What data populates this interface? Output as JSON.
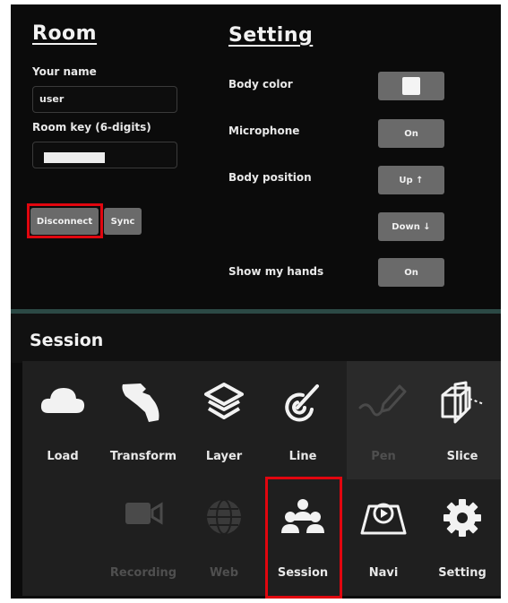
{
  "room": {
    "title": "Room",
    "your_name_label": "Your name",
    "your_name_value": "user",
    "room_key_label": "Room key (6-digits)",
    "disconnect_label": "Disconnect",
    "sync_label": "Sync"
  },
  "setting": {
    "title": "Setting",
    "body_color_label": "Body color",
    "microphone_label": "Microphone",
    "microphone_value": "On",
    "body_position_label": "Body position",
    "up_label": "Up ↑",
    "down_label": "Down ↓",
    "show_hands_label": "Show my hands",
    "show_hands_value": "On"
  },
  "session": {
    "title": "Session"
  },
  "tools": [
    {
      "label": "Load",
      "icon": "cloud-icon",
      "enabled": true
    },
    {
      "label": "Transform",
      "icon": "hand-icon",
      "enabled": true
    },
    {
      "label": "Layer",
      "icon": "layers-icon",
      "enabled": true
    },
    {
      "label": "Line",
      "icon": "line-icon",
      "enabled": true
    },
    {
      "label": "Pen",
      "icon": "pen-icon",
      "enabled": false
    },
    {
      "label": "Slice",
      "icon": "slice-icon",
      "enabled": true
    },
    {
      "label": "Recording",
      "icon": "camera-icon",
      "enabled": false
    },
    {
      "label": "Web",
      "icon": "globe-icon",
      "enabled": false
    },
    {
      "label": "Session",
      "icon": "people-icon",
      "enabled": true,
      "highlighted": true
    },
    {
      "label": "Navi",
      "icon": "navi-icon",
      "enabled": true
    },
    {
      "label": "Setting",
      "icon": "gear-icon",
      "enabled": true
    }
  ],
  "colors": {
    "panel_bg": "#0b0b0b",
    "button_gray": "#6a6a6a",
    "highlight_red": "#e1060f",
    "divider_teal": "#2c4945"
  }
}
